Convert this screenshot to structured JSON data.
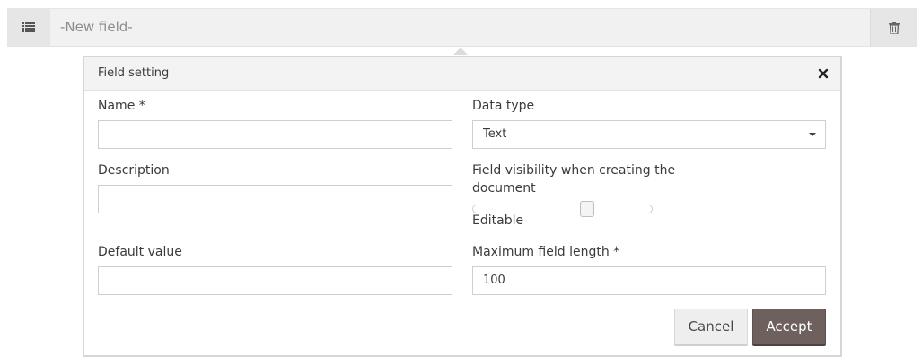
{
  "field_bar": {
    "title": "-New field-",
    "drag_icon": "list-icon",
    "delete_icon": "trash-icon"
  },
  "panel": {
    "title": "Field setting",
    "close_icon": "close-icon"
  },
  "form": {
    "name_label": "Name *",
    "name_value": "",
    "description_label": "Description",
    "description_value": "",
    "default_value_label": "Default value",
    "default_value_value": "",
    "data_type_label": "Data type",
    "data_type_value": "Text",
    "visibility_label_line1": "Field visibility when creating the",
    "visibility_label_line2": "document",
    "visibility_value": "Editable",
    "visibility_level": 0.65,
    "max_length_label": "Maximum field length *",
    "max_length_value": "100"
  },
  "buttons": {
    "cancel": "Cancel",
    "accept": "Accept"
  },
  "colors": {
    "accent": "#6e605c",
    "bar_background": "#f1f1f1"
  }
}
